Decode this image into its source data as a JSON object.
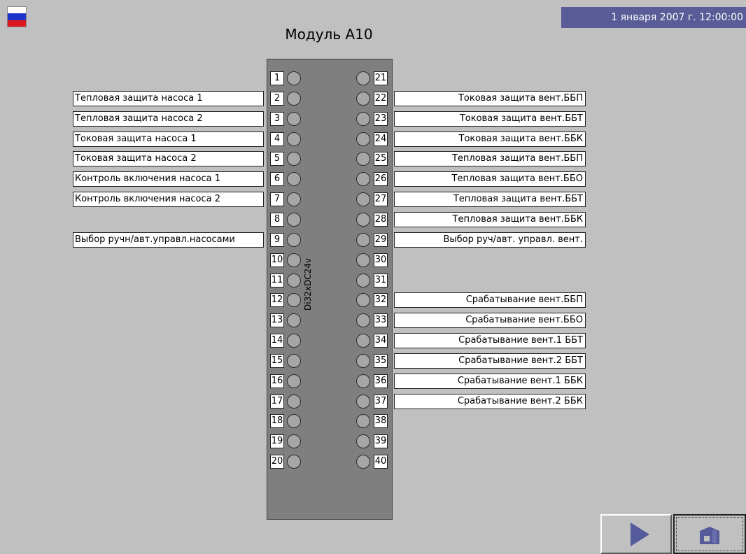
{
  "header": {
    "datetime": "1 января 2007 г. 12:00:00",
    "title": "Модуль A10"
  },
  "colors": {
    "background": "#c0c0c0",
    "datetime_bar": "#595c96",
    "module_body": "#7f7f7f",
    "led_off": "#a6a6a6",
    "accent_icon": "#555a9a"
  },
  "module": {
    "label": "Di32xDC24v"
  },
  "left_pins": [
    {
      "num": "1",
      "label": ""
    },
    {
      "num": "2",
      "label": "Тепловая защита насоса 1"
    },
    {
      "num": "3",
      "label": "Тепловая защита насоса 2"
    },
    {
      "num": "4",
      "label": "Токовая защита насоса 1"
    },
    {
      "num": "5",
      "label": "Токовая защита насоса 2"
    },
    {
      "num": "6",
      "label": "Контроль включения насоса 1"
    },
    {
      "num": "7",
      "label": "Контроль включения насоса 2"
    },
    {
      "num": "8",
      "label": ""
    },
    {
      "num": "9",
      "label": "Выбор ручн/авт.управл.насосами"
    },
    {
      "num": "10",
      "label": ""
    },
    {
      "num": "11",
      "label": ""
    },
    {
      "num": "12",
      "label": ""
    },
    {
      "num": "13",
      "label": ""
    },
    {
      "num": "14",
      "label": ""
    },
    {
      "num": "15",
      "label": ""
    },
    {
      "num": "16",
      "label": ""
    },
    {
      "num": "17",
      "label": ""
    },
    {
      "num": "18",
      "label": ""
    },
    {
      "num": "19",
      "label": ""
    },
    {
      "num": "20",
      "label": ""
    }
  ],
  "right_pins": [
    {
      "num": "21",
      "label": ""
    },
    {
      "num": "22",
      "label": "Токовая защита вент.ББП"
    },
    {
      "num": "23",
      "label": "Токовая защита вент.ББТ"
    },
    {
      "num": "24",
      "label": "Токовая защита вент.ББК"
    },
    {
      "num": "25",
      "label": "Тепловая защита вент.ББП"
    },
    {
      "num": "26",
      "label": "Тепловая защита вент.ББО"
    },
    {
      "num": "27",
      "label": "Тепловая защита вент.ББТ"
    },
    {
      "num": "28",
      "label": "Тепловая защита вент.ББК"
    },
    {
      "num": "29",
      "label": "Выбор руч/авт. управл. вент."
    },
    {
      "num": "30",
      "label": ""
    },
    {
      "num": "31",
      "label": ""
    },
    {
      "num": "32",
      "label": "Срабатывание вент.ББП"
    },
    {
      "num": "33",
      "label": "Срабатывание вент.ББО"
    },
    {
      "num": "34",
      "label": "Срабатывание вент.1 ББТ"
    },
    {
      "num": "35",
      "label": "Срабатывание вент.2 ББТ"
    },
    {
      "num": "36",
      "label": "Срабатывание вент.1 ББК"
    },
    {
      "num": "37",
      "label": "Срабатывание вент.2 ББК"
    },
    {
      "num": "38",
      "label": ""
    },
    {
      "num": "39",
      "label": ""
    },
    {
      "num": "40",
      "label": ""
    }
  ],
  "icons": {
    "language": "russian-flag-icon",
    "next": "play-arrow-icon",
    "home": "home-icon"
  }
}
